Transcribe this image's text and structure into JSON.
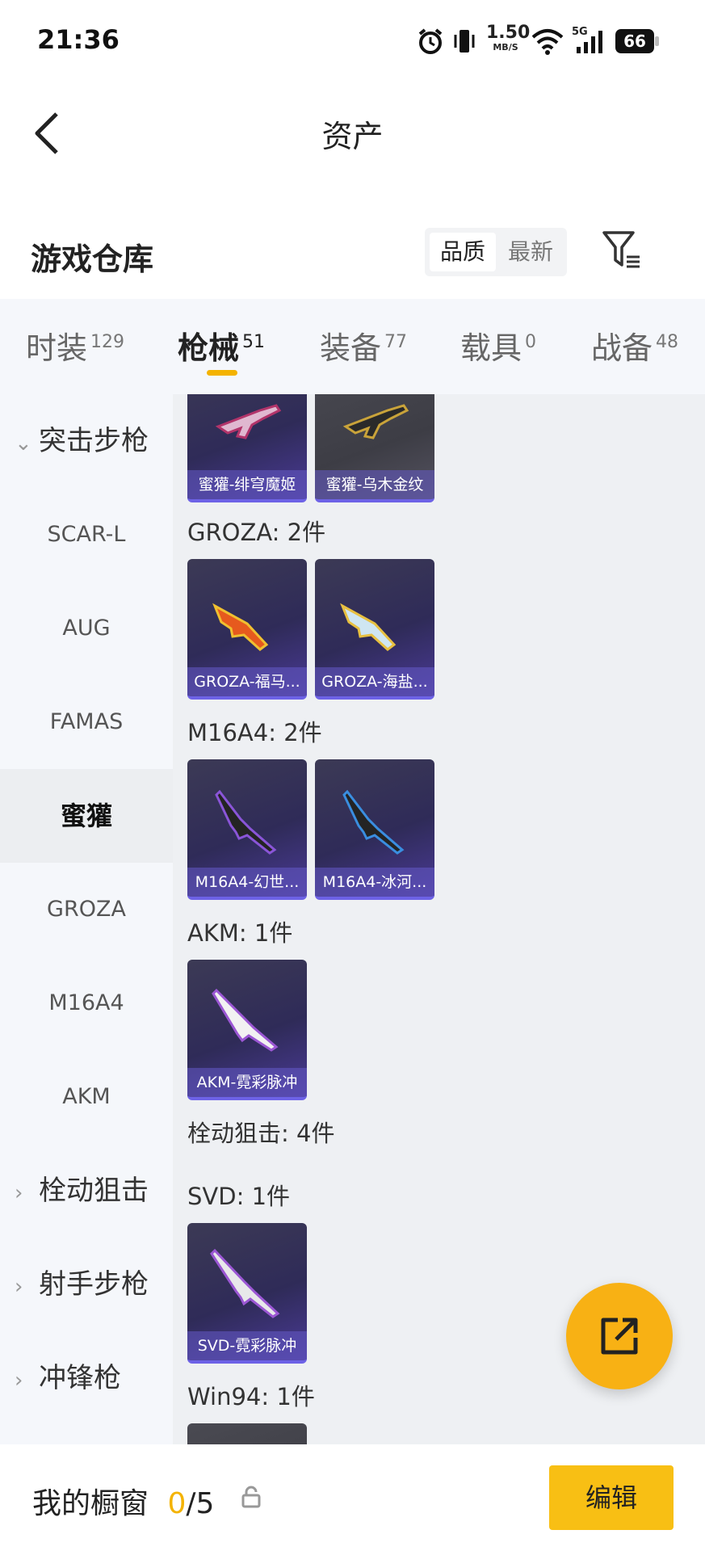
{
  "status_bar": {
    "time": "21:36",
    "network_speed": "1.50",
    "network_speed_unit": "MB/S",
    "signal_type": "5G",
    "battery": "66"
  },
  "header": {
    "title": "资产"
  },
  "warehouse": {
    "title": "游戏仓库",
    "sort_options": [
      "品质",
      "最新"
    ],
    "sort_selected": "品质"
  },
  "tabs": [
    {
      "label": "时装",
      "count": "129"
    },
    {
      "label": "枪械",
      "count": "51",
      "active": true
    },
    {
      "label": "装备",
      "count": "77"
    },
    {
      "label": "载具",
      "count": "0"
    },
    {
      "label": "战备",
      "count": "48"
    }
  ],
  "nav": [
    {
      "label": "突击步枪",
      "type": "category",
      "expanded": true
    },
    {
      "label": "SCAR-L",
      "type": "sub"
    },
    {
      "label": "AUG",
      "type": "sub"
    },
    {
      "label": "FAMAS",
      "type": "sub"
    },
    {
      "label": "蜜獾",
      "type": "sub",
      "selected": true
    },
    {
      "label": "GROZA",
      "type": "sub"
    },
    {
      "label": "M16A4",
      "type": "sub"
    },
    {
      "label": "AKM",
      "type": "sub"
    },
    {
      "label": "栓动狙击",
      "type": "category"
    },
    {
      "label": "射手步枪",
      "type": "category"
    },
    {
      "label": "冲锋枪",
      "type": "category"
    }
  ],
  "content": {
    "honey_badger_items": [
      "蜜獾-绯穹魔姬",
      "蜜獾-乌木金纹"
    ],
    "groups": [
      {
        "title": "GROZA: 2件",
        "items": [
          "GROZA-福马...",
          "GROZA-海盐..."
        ]
      },
      {
        "title": "M16A4: 2件",
        "items": [
          "M16A4-幻世...",
          "M16A4-冰河..."
        ]
      },
      {
        "title": "AKM: 1件",
        "items": [
          "AKM-霓彩脉冲"
        ]
      },
      {
        "title": "栓动狙击: 4件",
        "items": []
      },
      {
        "title": "SVD: 1件",
        "items": [
          "SVD-霓彩脉冲"
        ]
      },
      {
        "title": "Win94: 1件",
        "items": []
      }
    ]
  },
  "bottom_bar": {
    "label": "我的橱窗",
    "count_current": "0",
    "count_sep_total": "/5",
    "edit_label": "编辑"
  },
  "colors": {
    "accent": "#f4b300",
    "card_bottom": "#6d62e6"
  },
  "icons": [
    "back-icon",
    "filter-icon",
    "share-icon",
    "lock-icon",
    "chevron-right-icon",
    "chevron-down-icon"
  ]
}
